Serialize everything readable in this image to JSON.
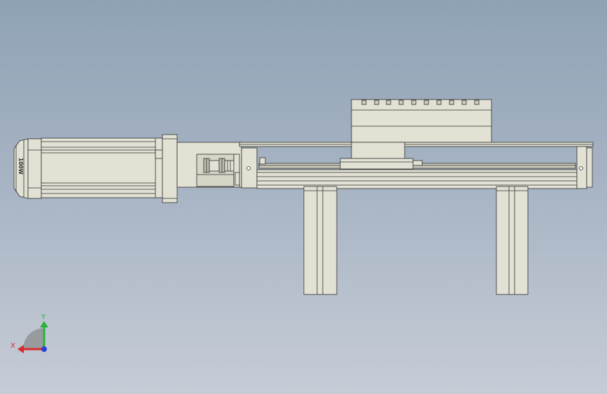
{
  "viewport": {
    "name": "cad-graphics-area",
    "background_top": "#8fa2b5",
    "background_bottom": "#c6ccd6"
  },
  "model": {
    "name": "linear-actuator-assembly",
    "body_color": "#e2e1d4",
    "edge_color": "#2f2f2f",
    "motor_label": "100W"
  },
  "triad": {
    "x_label": "X",
    "y_label": "Y",
    "x_color": "#d82a2a",
    "y_color": "#26b43a",
    "z_color": "#2a3fd8"
  }
}
